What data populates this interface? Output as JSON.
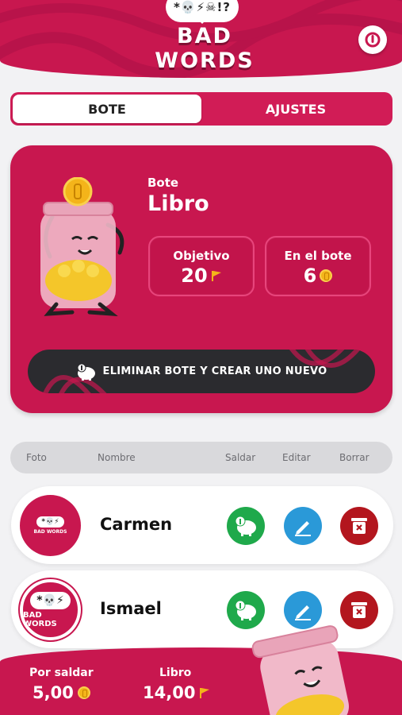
{
  "header": {
    "bubble_text": "*💀⚡☠!?",
    "title": "BAD WORDS",
    "power_icon": "power-icon"
  },
  "tabs": [
    {
      "label": "BOTE",
      "active": true
    },
    {
      "label": "AJUSTES",
      "active": false
    }
  ],
  "pot": {
    "label": "Bote",
    "name": "Libro",
    "goal": {
      "label": "Objetivo",
      "value": "20"
    },
    "in_pot": {
      "label": "En el bote",
      "value": "6"
    },
    "delete_button": "ELIMINAR BOTE Y CREAR UNO NUEVO"
  },
  "table": {
    "headers": {
      "photo": "Foto",
      "name": "Nombre",
      "settle": "Saldar",
      "edit": "Editar",
      "delete": "Borrar"
    },
    "rows": [
      {
        "name": "Carmen",
        "avatar_brand": "BAD WORDS",
        "avatar_bubble": "*💀⚡"
      },
      {
        "name": "Ismael",
        "avatar_brand": "BAD WORDS",
        "avatar_bubble": "*💀⚡"
      }
    ]
  },
  "footer": {
    "due_label": "Por saldar",
    "due_value": "5,00",
    "pot_label": "Libro",
    "pot_value": "14,00"
  },
  "colors": {
    "brand": "#c8174f",
    "green": "#1fa94b",
    "blue": "#2a99d8",
    "red": "#b3161e",
    "coin": "#f4b41a"
  }
}
